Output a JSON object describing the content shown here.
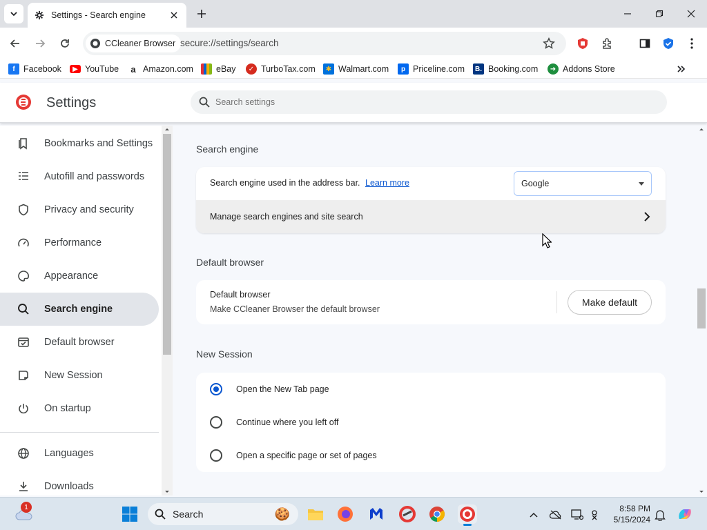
{
  "window": {
    "tab_title": "Settings - Search engine"
  },
  "toolbar": {
    "site_chip": "CCleaner Browser",
    "url": "secure://settings/search"
  },
  "bookmarks": [
    {
      "label": "Facebook",
      "icon": "facebook-icon",
      "color": "#1877f2"
    },
    {
      "label": "YouTube",
      "icon": "youtube-icon",
      "color": "#ff0000"
    },
    {
      "label": "Amazon.com",
      "icon": "amazon-icon",
      "color": "#222222"
    },
    {
      "label": "eBay",
      "icon": "ebay-icon",
      "color": "#e53238"
    },
    {
      "label": "TurboTax.com",
      "icon": "turbotax-icon",
      "color": "#d52b1e"
    },
    {
      "label": "Walmart.com",
      "icon": "walmart-icon",
      "color": "#0071dc"
    },
    {
      "label": "Priceline.com",
      "icon": "priceline-icon",
      "color": "#0068ef"
    },
    {
      "label": "Booking.com",
      "icon": "booking-icon",
      "color": "#003580"
    },
    {
      "label": "Addons Store",
      "icon": "addons-store-icon",
      "color": "#1e8e3e"
    }
  ],
  "settings": {
    "title": "Settings",
    "search_placeholder": "Search settings"
  },
  "sidebar": {
    "items": [
      {
        "label": "Bookmarks and Settings",
        "icon": "bookmarks-icon"
      },
      {
        "label": "Autofill and passwords",
        "icon": "autofill-icon"
      },
      {
        "label": "Privacy and security",
        "icon": "shield-icon"
      },
      {
        "label": "Performance",
        "icon": "gauge-icon"
      },
      {
        "label": "Appearance",
        "icon": "palette-icon"
      },
      {
        "label": "Search engine",
        "icon": "search-icon",
        "active": true
      },
      {
        "label": "Default browser",
        "icon": "browser-icon"
      },
      {
        "label": "New Session",
        "icon": "new-session-icon"
      },
      {
        "label": "On startup",
        "icon": "power-icon"
      },
      {
        "label": "Languages",
        "icon": "globe-icon"
      },
      {
        "label": "Downloads",
        "icon": "download-icon"
      }
    ]
  },
  "search_engine": {
    "heading": "Search engine",
    "row_label": "Search engine used in the address bar.",
    "learn_more": "Learn more",
    "selected_engine": "Google",
    "manage_label": "Manage search engines and site search"
  },
  "default_browser": {
    "heading": "Default browser",
    "title": "Default browser",
    "subtitle": "Make CCleaner Browser the default browser",
    "button": "Make default"
  },
  "new_session": {
    "heading": "New Session",
    "options": [
      {
        "label": "Open the New Tab page",
        "checked": true
      },
      {
        "label": "Continue where you left off",
        "checked": false
      },
      {
        "label": "Open a specific page or set of pages",
        "checked": false
      }
    ]
  },
  "taskbar": {
    "search_label": "Search",
    "time": "8:58 PM",
    "date": "5/15/2024",
    "weather_badge": "1"
  },
  "colors": {
    "accent": "#0b57d0",
    "active_nav": "#e2e5ea"
  }
}
